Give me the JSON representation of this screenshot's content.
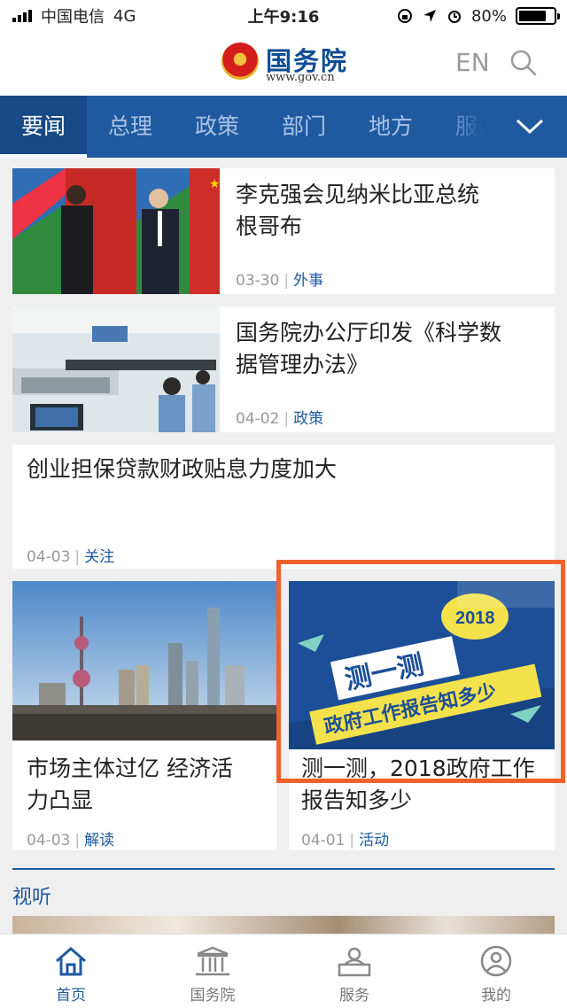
{
  "status_bar": {
    "carrier": "中国电信",
    "network": "4G",
    "time": "上午9:16",
    "battery": "80%",
    "battery_level": 0.8
  },
  "header": {
    "logo_text": "国务院",
    "logo_url": "www.gov.cn",
    "lang_button": "EN",
    "icons": [
      "national-emblem-icon",
      "search-icon"
    ]
  },
  "nav": {
    "tabs": [
      {
        "label": "要闻",
        "active": true
      },
      {
        "label": "总理",
        "active": false
      },
      {
        "label": "政策",
        "active": false
      },
      {
        "label": "部门",
        "active": false
      },
      {
        "label": "地方",
        "active": false
      },
      {
        "label": "服务",
        "active": false
      }
    ],
    "more_icon": "chevron-down-icon"
  },
  "articles": [
    {
      "title_line1": "李克强会见纳米比亚总统",
      "title_line2": "根哥布",
      "date": "03-30",
      "category": "外事"
    },
    {
      "title_line1": "国务院办公厅印发《科学数",
      "title_line2": "据管理办法》",
      "date": "04-02",
      "category": "政策"
    },
    {
      "title_line1": "创业担保贷款财政贴息力度加大",
      "date": "04-03",
      "category": "关注"
    },
    {
      "title_line1": "市场主体过亿 经济活",
      "title_line2": "力凸显",
      "date": "04-03",
      "category": "解读"
    },
    {
      "title_line1": "测一测，2018政府工作",
      "title_line2": "报告知多少",
      "date": "04-01",
      "category": "活动",
      "banner": {
        "year": "2018",
        "headline": "测一测",
        "subline": "政府工作报告知多少"
      }
    }
  ],
  "section": {
    "title": "视听"
  },
  "tabbar": {
    "items": [
      {
        "label": "首页",
        "icon": "home-icon",
        "active": true
      },
      {
        "label": "国务院",
        "icon": "building-icon",
        "active": false
      },
      {
        "label": "服务",
        "icon": "service-icon",
        "active": false
      },
      {
        "label": "我的",
        "icon": "profile-icon",
        "active": false
      }
    ]
  },
  "colors": {
    "brand_blue": "#1f5aa1",
    "highlight": "#f0612b"
  }
}
